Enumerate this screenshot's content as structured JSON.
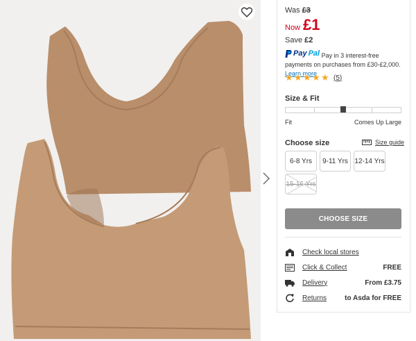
{
  "price": {
    "was_label": "Was",
    "was_value": "£3",
    "now_label": "Now",
    "now_value": "£1",
    "save_label": "Save",
    "save_value": "£2"
  },
  "paypal": {
    "logo_pay": "Pay",
    "logo_pal": "Pal",
    "text": "Pay in 3 interest-free payments on purchases from £30-£2,000.",
    "link": "Learn more"
  },
  "rating": {
    "stars": 5,
    "count": "(5)",
    "color": "#f5a623"
  },
  "fit": {
    "title": "Size & Fit",
    "label_left": "Fit",
    "label_right": "Comes Up Large"
  },
  "sizes": {
    "title": "Choose size",
    "guide_label": "Size guide",
    "options": [
      {
        "label": "6-8 Yrs",
        "available": true
      },
      {
        "label": "9-11 Yrs",
        "available": true
      },
      {
        "label": "12-14 Yrs",
        "available": true
      },
      {
        "label": "15-16 Yrs",
        "available": false
      }
    ],
    "choose_button": "CHOOSE SIZE"
  },
  "services": [
    {
      "icon": "store-icon",
      "link": "Check local stores",
      "value": ""
    },
    {
      "icon": "click-collect-icon",
      "link": "Click & Collect",
      "value": "FREE"
    },
    {
      "icon": "delivery-truck-icon",
      "link": "Delivery",
      "value": "From £3.75"
    },
    {
      "icon": "returns-icon",
      "link": "Returns",
      "value": "to Asda for FREE"
    }
  ],
  "colors": {
    "price_red": "#d0021b",
    "button_grey": "#8b8b8b",
    "paypal_blue": "#003087",
    "link_blue": "#0070ba",
    "product_tan": "#c49b76"
  }
}
